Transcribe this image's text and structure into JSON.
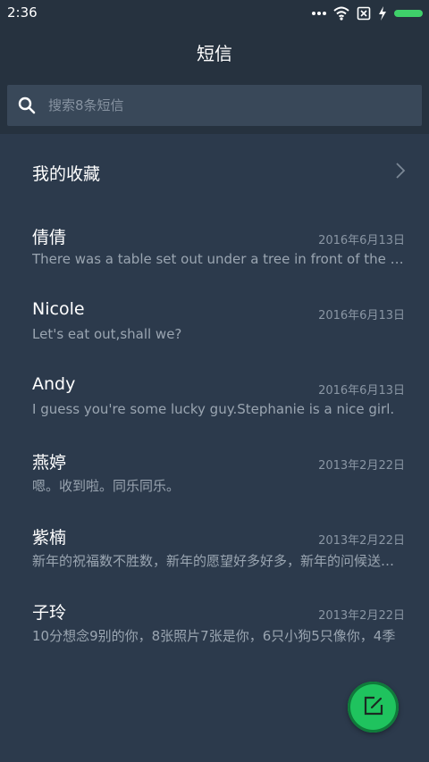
{
  "status_bar": {
    "time": "2:36"
  },
  "header": {
    "title": "短信"
  },
  "search": {
    "placeholder": "搜索8条短信"
  },
  "favorites": {
    "label": "我的收藏"
  },
  "messages": [
    {
      "name": "倩倩",
      "date": "2016年6月13日",
      "preview": "There was a table set out under a tree in front of the house"
    },
    {
      "name": "Nicole",
      "date": "2016年6月13日",
      "preview": "Let's eat out,shall we?"
    },
    {
      "name": "Andy",
      "date": "2016年6月13日",
      "preview": "I guess you're some lucky guy.Stephanie is a nice girl."
    },
    {
      "name": "燕婷",
      "date": "2013年2月22日",
      "preview": "嗯。收到啦。同乐同乐。"
    },
    {
      "name": "紫楠",
      "date": "2013年2月22日",
      "preview": "新年的祝福数不胜数，新年的愿望好多好多，新年的问候送给你"
    },
    {
      "name": "子玲",
      "date": "2013年2月22日",
      "preview": "10分想念9别的你，8张照片7张是你，6只小狗5只像你，4季"
    }
  ],
  "colors": {
    "background": "#2c3a4c",
    "header": "#26323f",
    "search_box": "#394859",
    "fab": "#1fc35e",
    "battery": "#3fd06a"
  },
  "icons": {
    "status": [
      "more-dots-icon",
      "wifi-icon",
      "no-sim-icon",
      "charging-icon",
      "battery-icon"
    ],
    "search": "search-icon",
    "favorites": "chevron-right-icon",
    "fab": "compose-icon"
  }
}
